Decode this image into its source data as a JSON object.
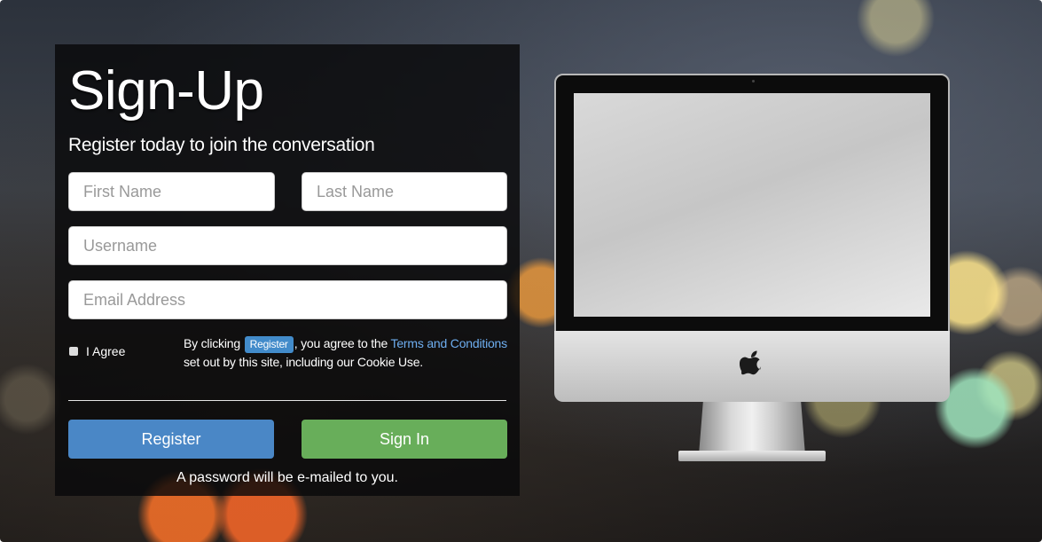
{
  "signup": {
    "title": "Sign-Up",
    "subtitle": "Register today to join the conversation",
    "first_name_placeholder": "First Name",
    "last_name_placeholder": "Last Name",
    "username_placeholder": "Username",
    "email_placeholder": "Email Address",
    "agree_label": "I Agree",
    "terms": {
      "prefix": "By clicking",
      "badge": "Register",
      "middle": ", you agree to the",
      "link": "Terms and Conditions",
      "suffix": "set out by this site, including our Cookie Use."
    },
    "register_label": "Register",
    "signin_label": "Sign In",
    "note": "A password will be e-mailed to you."
  },
  "colors": {
    "register_button": "#4a87c6",
    "signin_button": "#68ae5a",
    "link": "#6eaef0"
  },
  "illustration": {
    "icon": "apple-logo-icon"
  }
}
